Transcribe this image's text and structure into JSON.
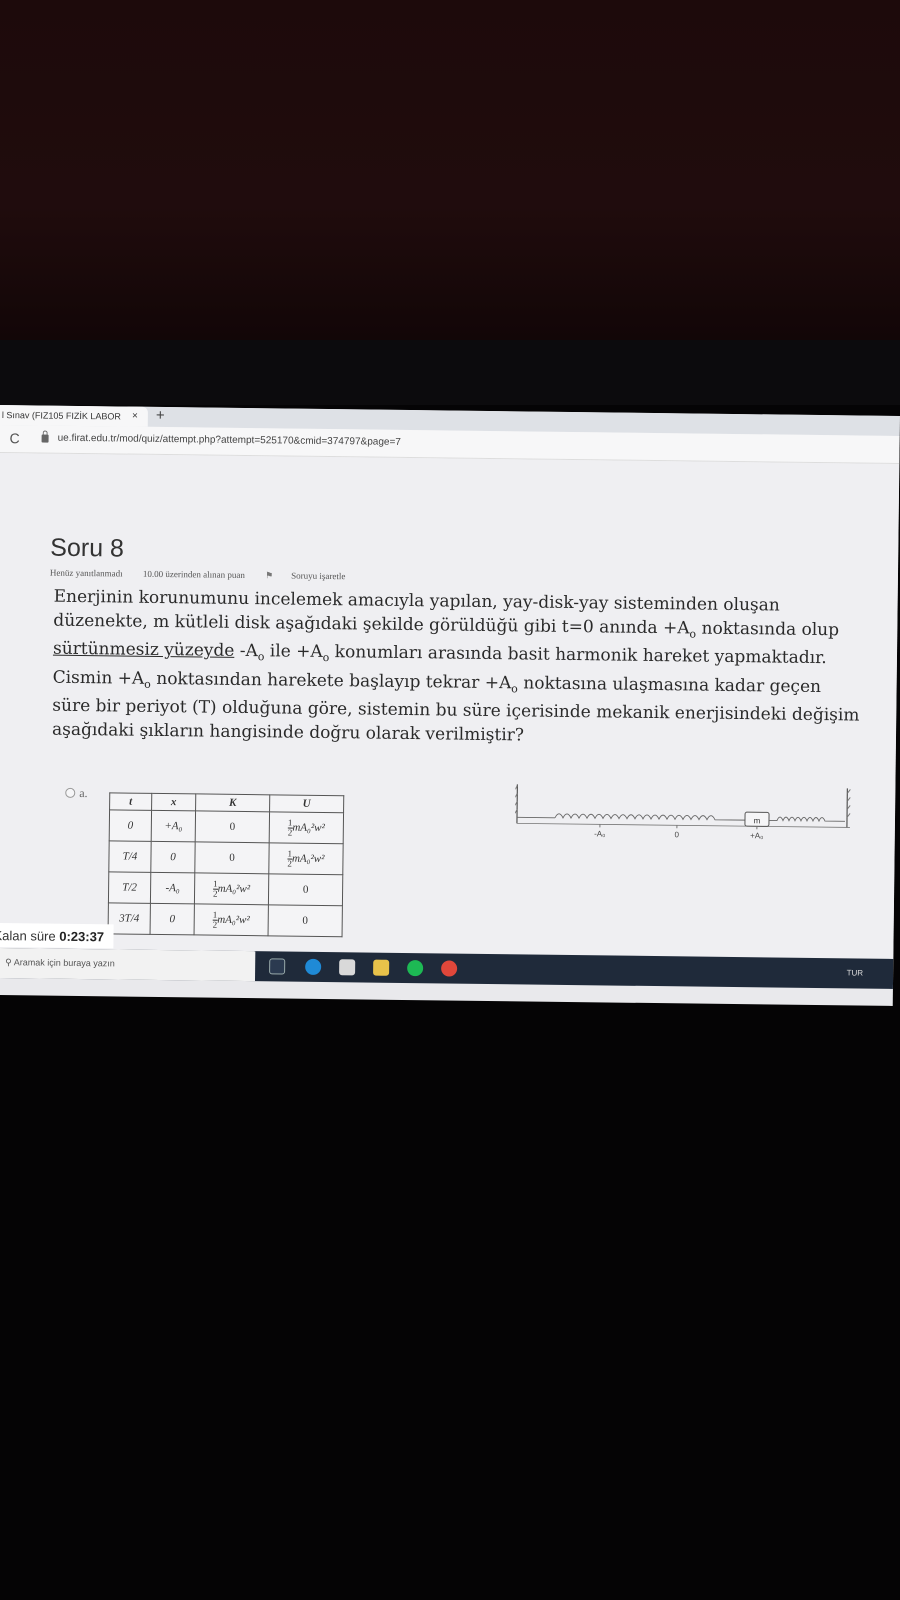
{
  "browser": {
    "tab_title": "l Sınav (FIZ105 FIZİK LABOR",
    "tab_close": "×",
    "new_tab": "+",
    "reload": "C",
    "url": "ue.firat.edu.tr/mod/quiz/attempt.php?attempt=525170&cmid=374797&page=7"
  },
  "question": {
    "title": "Soru 8",
    "status": "Henüz yanıtlanmadı",
    "points": "10.00 üzerinden alınan puan",
    "flag_label": "Soruyu işaretle",
    "text_part1": "Enerjinin korunumunu incelemek amacıyla yapılan, yay-disk-yay sisteminden oluşan düzenekte, m kütleli disk aşağıdaki şekilde görüldüğü gibi t=0 anında +A",
    "text_part2": " noktasında olup ",
    "text_underlined": "sürtünmesiz yüzeyde",
    "text_part3": " -A",
    "text_part4": " ile +A",
    "text_part5": " konumları arasında basit harmonik hareket yapmaktadır. Cismin +A",
    "text_part6": " noktasından harekete başlayıp tekrar +A",
    "text_part7": " noktasına ulaşmasına kadar geçen süre bir periyot (T) olduğuna göre, sistemin bu süre içerisinde mekanik enerjisindeki değişim aşağıdaki şıkların hangisinde doğru olarak verilmiştir?",
    "subscript": "o"
  },
  "option_a": {
    "label": "a.",
    "headers": [
      "t",
      "x",
      "K",
      "U"
    ],
    "rows": [
      {
        "t": "0",
        "x": "+A₀",
        "K": "0",
        "U": "mA₀²w²",
        "U_half": true,
        "K_half": false
      },
      {
        "t": "T/4",
        "x": "0",
        "K": "0",
        "U": "mA₀²w²",
        "U_half": true,
        "K_half": false
      },
      {
        "t": "T/2",
        "x": "-A₀",
        "K": "mA₀²w²",
        "U": "0",
        "U_half": false,
        "K_half": true
      },
      {
        "t": "3T/4",
        "x": "0",
        "K": "mA₀²w²",
        "U": "0",
        "U_half": false,
        "K_half": true
      }
    ],
    "fraction_num": "1",
    "fraction_den": "2"
  },
  "diagram": {
    "mass_label": "m",
    "left_label": "-A₀",
    "center_label": "0",
    "right_label": "+A₀"
  },
  "timer": {
    "label": "Kalan süre ",
    "value": "0:23:37"
  },
  "taskbar": {
    "search_placeholder": "Aramak için buraya yazın",
    "tray_lang": "TUR"
  }
}
